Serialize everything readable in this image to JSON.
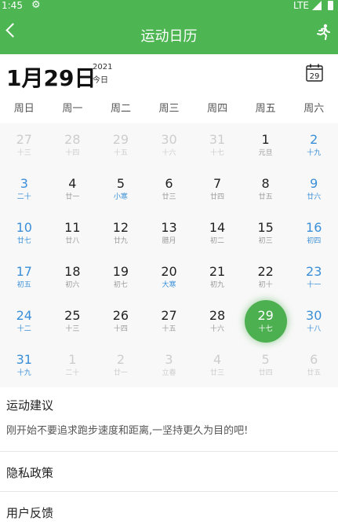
{
  "status_bar": {
    "time": "1:45",
    "network": "LTE"
  },
  "app_bar": {
    "title": "运动日历"
  },
  "header": {
    "date": "1月29日",
    "year": "2021",
    "today": "今日",
    "calendar_icon_day": "29"
  },
  "weekdays": [
    "周日",
    "周一",
    "周二",
    "周三",
    "周四",
    "周五",
    "周六"
  ],
  "days": [
    {
      "day": "27",
      "lunar": "十三",
      "other": true
    },
    {
      "day": "28",
      "lunar": "十四",
      "other": true
    },
    {
      "day": "29",
      "lunar": "十五",
      "other": true
    },
    {
      "day": "30",
      "lunar": "十六",
      "other": true
    },
    {
      "day": "31",
      "lunar": "十七",
      "other": true
    },
    {
      "day": "1",
      "lunar": "元旦"
    },
    {
      "day": "2",
      "lunar": "十九"
    },
    {
      "day": "3",
      "lunar": "二十"
    },
    {
      "day": "4",
      "lunar": "廿一"
    },
    {
      "day": "5",
      "lunar": "小寒",
      "term": true
    },
    {
      "day": "6",
      "lunar": "廿三"
    },
    {
      "day": "7",
      "lunar": "廿四"
    },
    {
      "day": "8",
      "lunar": "廿五"
    },
    {
      "day": "9",
      "lunar": "廿六"
    },
    {
      "day": "10",
      "lunar": "廿七"
    },
    {
      "day": "11",
      "lunar": "廿八"
    },
    {
      "day": "12",
      "lunar": "廿九"
    },
    {
      "day": "13",
      "lunar": "腊月"
    },
    {
      "day": "14",
      "lunar": "初二"
    },
    {
      "day": "15",
      "lunar": "初三"
    },
    {
      "day": "16",
      "lunar": "初四"
    },
    {
      "day": "17",
      "lunar": "初五"
    },
    {
      "day": "18",
      "lunar": "初六"
    },
    {
      "day": "19",
      "lunar": "初七"
    },
    {
      "day": "20",
      "lunar": "大寒",
      "term": true
    },
    {
      "day": "21",
      "lunar": "初九"
    },
    {
      "day": "22",
      "lunar": "初十"
    },
    {
      "day": "23",
      "lunar": "十一"
    },
    {
      "day": "24",
      "lunar": "十二"
    },
    {
      "day": "25",
      "lunar": "十三"
    },
    {
      "day": "26",
      "lunar": "十四"
    },
    {
      "day": "27",
      "lunar": "十五"
    },
    {
      "day": "28",
      "lunar": "十六"
    },
    {
      "day": "29",
      "lunar": "十七",
      "selected": true
    },
    {
      "day": "30",
      "lunar": "十八"
    },
    {
      "day": "31",
      "lunar": "十九"
    },
    {
      "day": "1",
      "lunar": "二十",
      "other": true
    },
    {
      "day": "2",
      "lunar": "廿一",
      "other": true
    },
    {
      "day": "3",
      "lunar": "立春",
      "other": true
    },
    {
      "day": "4",
      "lunar": "廿三",
      "other": true
    },
    {
      "day": "5",
      "lunar": "廿四",
      "other": true
    },
    {
      "day": "6",
      "lunar": "廿五",
      "other": true
    }
  ],
  "advice": {
    "title": "运动建议",
    "text": "刚开始不要追求跑步速度和距离,一坚持更久为目的吧!"
  },
  "menu": {
    "privacy": "隐私政策",
    "feedback": "用户反馈"
  },
  "colors": {
    "primary": "#4db653",
    "weekend": "#3a8fd8",
    "selected": "#4caf50"
  }
}
